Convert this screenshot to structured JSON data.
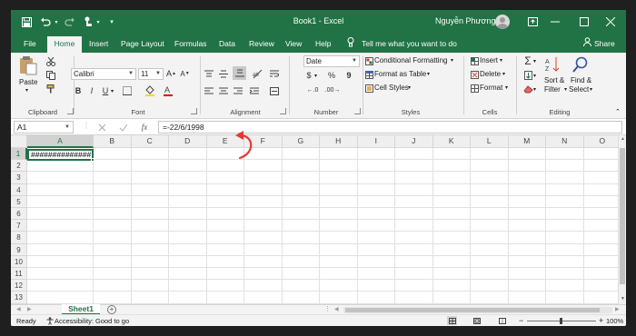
{
  "window": {
    "title": "Book1  -  Excel",
    "user": "Nguyễn Phương",
    "accent": "#217346"
  },
  "quick_access": {
    "save_icon": "save-icon",
    "undo_icon": "undo-icon",
    "redo_icon": "redo-icon",
    "touch_icon": "touch-mode-icon",
    "customize_icon": "customize-icon"
  },
  "tabs": [
    "File",
    "Home",
    "Insert",
    "Page Layout",
    "Formulas",
    "Data",
    "Review",
    "View",
    "Help"
  ],
  "active_tab": "Home",
  "tell_me": "Tell me what you want to do",
  "share": "Share",
  "ribbon": {
    "clipboard": {
      "label": "Clipboard",
      "paste": "Paste"
    },
    "font": {
      "label": "Font",
      "font_name": "Calibri",
      "font_size": "11",
      "bold": "B",
      "italic": "I",
      "underline": "U"
    },
    "alignment": {
      "label": "Alignment"
    },
    "number": {
      "label": "Number",
      "format": "Date",
      "currency": "$",
      "percent": "%",
      "comma": "9"
    },
    "styles": {
      "label": "Styles",
      "conditional": "Conditional Formatting",
      "format_table": "Format as Table",
      "cell_styles": "Cell Styles"
    },
    "cells": {
      "label": "Cells",
      "insert": "Insert",
      "delete": "Delete",
      "format": "Format"
    },
    "editing": {
      "label": "Editing",
      "sort": "Sort &",
      "filter": "Filter",
      "find": "Find &",
      "select": "Select"
    }
  },
  "formula_bar": {
    "name_box": "A1",
    "fx": "fx",
    "formula": "=-22/6/1998"
  },
  "columns": [
    "A",
    "B",
    "C",
    "D",
    "E",
    "F",
    "G",
    "H",
    "I",
    "J",
    "K",
    "L",
    "M",
    "N",
    "O"
  ],
  "rows": [
    "1",
    "2",
    "3",
    "4",
    "5",
    "6",
    "7",
    "8",
    "9",
    "10",
    "11",
    "12",
    "13"
  ],
  "active_cell": {
    "ref": "A1",
    "display": "##############"
  },
  "sheets": [
    "Sheet1"
  ],
  "status": {
    "ready": "Ready",
    "accessibility": "Accessibility: Good to go",
    "zoom": "100%"
  }
}
